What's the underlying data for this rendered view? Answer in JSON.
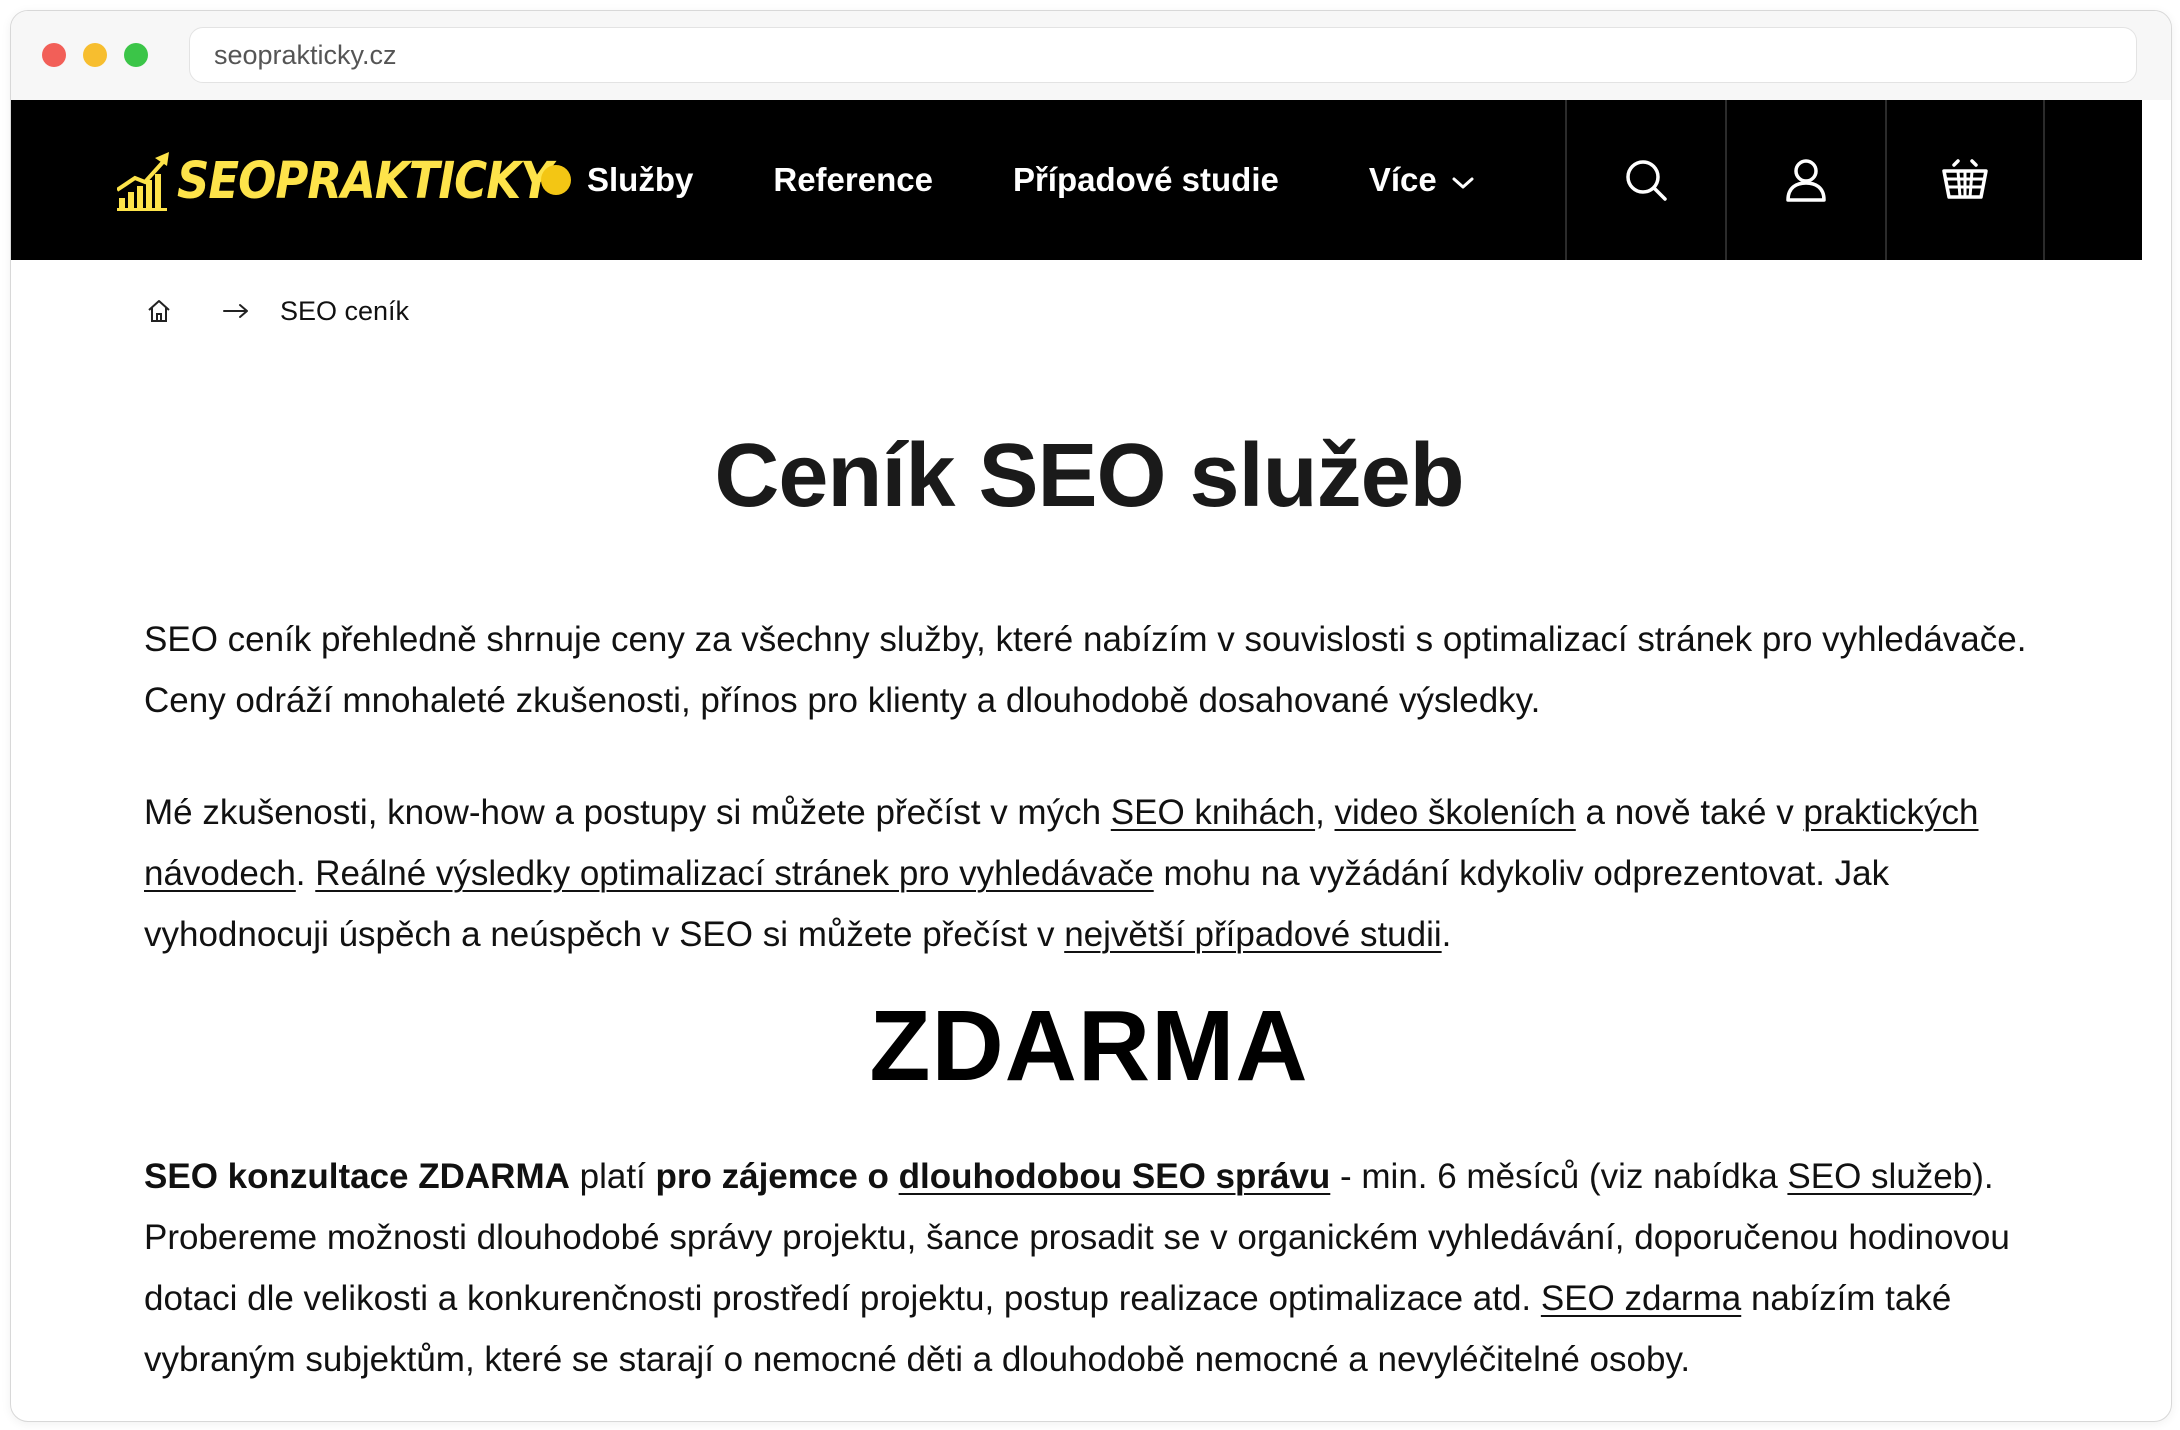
{
  "browser": {
    "url": "seoprakticky.cz"
  },
  "nav": {
    "logo_text": "SEOPRAKTICKY",
    "items": [
      {
        "label": "Služby"
      },
      {
        "label": "Reference"
      },
      {
        "label": "Případové studie"
      },
      {
        "label": "Více"
      }
    ],
    "icons": [
      "search-icon",
      "user-icon",
      "basket-icon"
    ],
    "colors": {
      "accent": "#fde34a",
      "dot": "#f3c614",
      "bar": "#000000"
    }
  },
  "breadcrumb": {
    "current": "SEO ceník"
  },
  "page": {
    "title": "Ceník SEO služeb",
    "p1": "SEO ceník přehledně shrnuje ceny za všechny služby, které nabízím v souvislosti s optimalizací stránek pro vyhledávače. Ceny odráží mnohaleté zkušenosti, přínos pro klienty a dlouhodobě dosahované výsledky.",
    "p2": {
      "t1": "Mé zkušenosti, know-how a postupy si můžete přečíst v mých ",
      "link1": "SEO knihách",
      "t2": ", ",
      "link2": "video školeních",
      "t3": " a nově také v ",
      "link3": "praktických návodech",
      "t4": ". ",
      "link4": "Reálné výsledky optimalizací stránek pro vyhledávače",
      "t5": " mohu na vyžádání kdykoliv odprezentovat. Jak vyhodnocuji úspěch a neúspěch v SEO si můžete přečíst v ",
      "link5": "největší případové studii",
      "t6": "."
    },
    "zdarma_heading": "ZDARMA",
    "p3": {
      "b1": "SEO konzultace ZDARMA",
      "t1": " platí ",
      "b2": "pro zájemce o ",
      "link1": "dlouhodobou SEO správu",
      "t2": " - min. 6 měsíců (viz nabídka ",
      "link2": "SEO služeb",
      "t3": "). Probereme možnosti dlouhodobé správy projektu, šance prosadit se v organickém vyhledávání, doporučenou hodinovou dotaci dle velikosti a konkurenčnosti prostředí projektu, postup realizace optimalizace atd. ",
      "link3": "SEO zdarma",
      "t4": " nabízím také vybraným subjektům, které se starají o nemocné děti a dlouhodobě nemocné a nevyléčitelné osoby."
    }
  }
}
